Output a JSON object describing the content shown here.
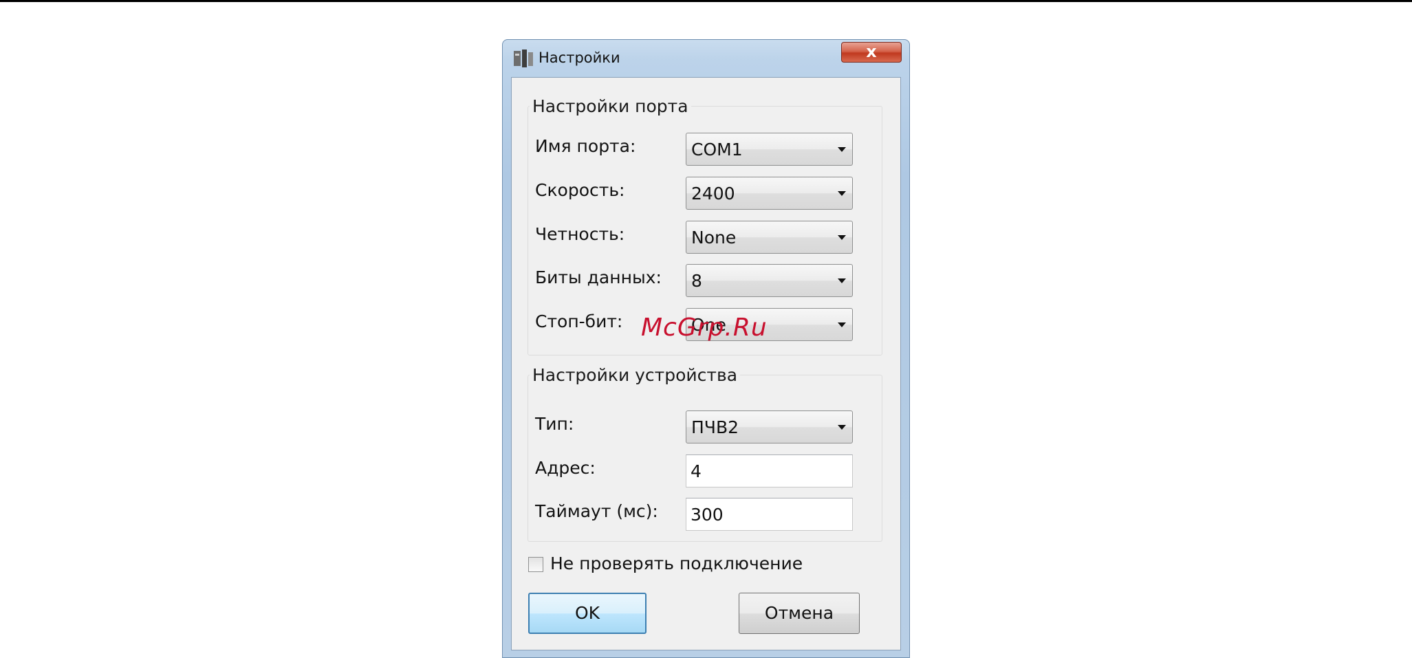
{
  "window": {
    "title": "Настройки",
    "close_label": "x"
  },
  "port_group": {
    "title": "Настройки порта",
    "port_name": {
      "label": "Имя порта:",
      "value": "COM1"
    },
    "speed": {
      "label": "Скорость:",
      "value": "2400"
    },
    "parity": {
      "label": "Четность:",
      "value": "None"
    },
    "data_bits": {
      "label": "Биты данных:",
      "value": "8"
    },
    "stop_bits": {
      "label": "Стоп-бит:",
      "value": "One"
    }
  },
  "device_group": {
    "title": "Настройки устройства",
    "type": {
      "label": "Тип:",
      "value": "ПЧВ2"
    },
    "address": {
      "label": "Адрес:",
      "value": "4"
    },
    "timeout": {
      "label": "Таймаут (мс):",
      "value": "300"
    }
  },
  "skip_check": {
    "label": "Не проверять подключение",
    "checked": false
  },
  "buttons": {
    "ok": "OK",
    "cancel": "Отмена"
  },
  "watermark": "McGrp.Ru"
}
